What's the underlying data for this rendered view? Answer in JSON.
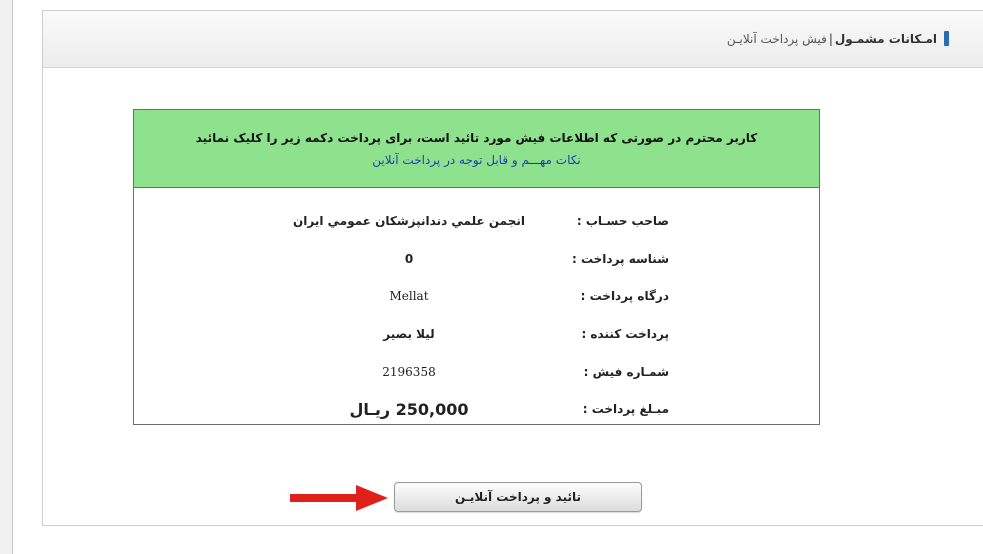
{
  "breadcrumb": {
    "section": "امـکانات مشمـول",
    "separator": "|",
    "current": "فیش پرداخت آنلایـن"
  },
  "receipt": {
    "notice": "کاربر محترم در صورتی که اطلاعات فیش مورد تائید است، برای پرداخت دکمه زیر را کلیک نمائید",
    "notes_link": "نکات مهـــم و قابل توجه در پرداخت آنلاین",
    "rows": [
      {
        "label": "صاحب حسـاب :",
        "value": "انجمن علمي دندانپزشکان عمومي ایران"
      },
      {
        "label": "شناسه پرداخت :",
        "value": "0"
      },
      {
        "label": "درگاه پرداخت :",
        "value": "Mellat"
      },
      {
        "label": "پرداخت کننده :",
        "value": "لیلا بصیر"
      },
      {
        "label": "شمـاره فیش :",
        "value": "2196358"
      },
      {
        "label": "مبـلغ پرداخت :",
        "value": "250,000 ریـال"
      }
    ]
  },
  "pay_button": {
    "label": "تائید و پرداخت آنلایـن"
  },
  "colors": {
    "header_green": "#8ee28e",
    "link_blue": "#1f3fae",
    "arrow_red": "#e0201b",
    "marker_blue": "#2b6cb3"
  }
}
